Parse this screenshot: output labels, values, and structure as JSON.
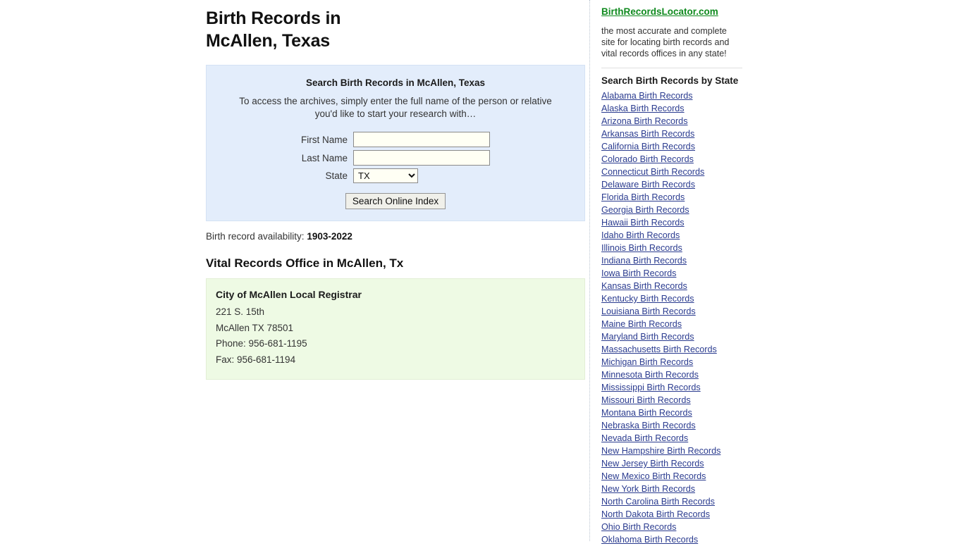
{
  "main": {
    "title_line1": "Birth Records in",
    "title_line2": "McAllen, Texas",
    "search_panel": {
      "title": "Search Birth Records in McAllen, Texas",
      "description": "To access the archives, simply enter the full name of the person or relative you'd like to start your research with…",
      "first_name_label": "First Name",
      "first_name_value": "",
      "first_name_placeholder": "",
      "last_name_label": "Last Name",
      "last_name_value": "",
      "last_name_placeholder": "",
      "state_label": "State",
      "state_selected": "TX",
      "state_options": [
        "TX"
      ],
      "submit_label": "Search Online Index"
    },
    "availability_label": "Birth record availability:",
    "availability_value": "1903-2022",
    "office_section_title": "Vital Records Office in McAllen, Tx",
    "office": {
      "name": "City of McAllen Local Registrar",
      "street": "221 S. 15th",
      "city_state_zip": "McAllen TX 78501",
      "phone": "Phone: 956-681-1195",
      "fax": "Fax: 956-681-1194"
    }
  },
  "sidebar": {
    "site_title": "BirthRecordsLocator.com",
    "tagline": "the most accurate and complete site for locating birth records and vital records offices in any state!",
    "states_heading": "Search Birth Records by State",
    "state_links": [
      "Alabama Birth Records",
      "Alaska Birth Records",
      "Arizona Birth Records",
      "Arkansas Birth Records",
      "California Birth Records",
      "Colorado Birth Records",
      "Connecticut Birth Records",
      "Delaware Birth Records",
      "Florida Birth Records",
      "Georgia Birth Records",
      "Hawaii Birth Records",
      "Idaho Birth Records",
      "Illinois Birth Records",
      "Indiana Birth Records",
      "Iowa Birth Records",
      "Kansas Birth Records",
      "Kentucky Birth Records",
      "Louisiana Birth Records",
      "Maine Birth Records",
      "Maryland Birth Records",
      "Massachusetts Birth Records",
      "Michigan Birth Records",
      "Minnesota Birth Records",
      "Mississippi Birth Records",
      "Missouri Birth Records",
      "Montana Birth Records",
      "Nebraska Birth Records",
      "Nevada Birth Records",
      "New Hampshire Birth Records",
      "New Jersey Birth Records",
      "New Mexico Birth Records",
      "New York Birth Records",
      "North Carolina Birth Records",
      "North Dakota Birth Records",
      "Ohio Birth Records",
      "Oklahoma Birth Records"
    ]
  },
  "colors": {
    "panel_blue": "#e3edfb",
    "panel_green": "#eefae4",
    "link_blue": "#2a3b8f",
    "site_title_green": "#0f8a1e"
  }
}
